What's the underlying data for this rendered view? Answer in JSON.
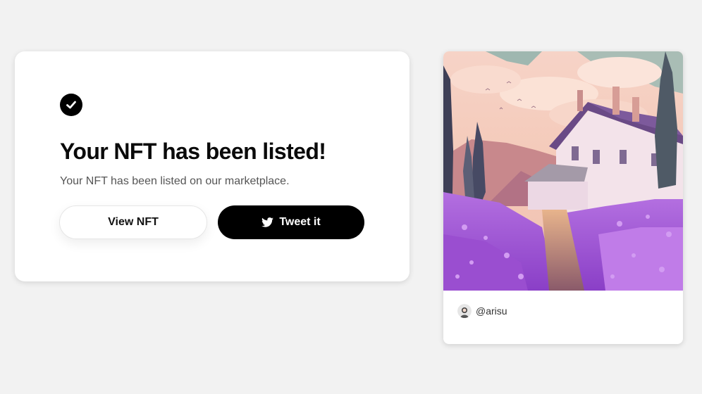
{
  "success": {
    "icon": "check-circle-icon",
    "title": "Your NFT has been listed!",
    "subtitle": "Your NFT has been listed on our marketplace.",
    "view_label": "View NFT",
    "tweet_label": "Tweet it",
    "tweet_icon": "twitter-icon"
  },
  "nft": {
    "image": "lavender-cottage-artwork",
    "owner": "@arisu",
    "avatar": "avatar-icon"
  },
  "colors": {
    "background": "#f2f2f2",
    "card": "#ffffff",
    "primary_button": "#000000",
    "lavender": "#a45ed8"
  }
}
